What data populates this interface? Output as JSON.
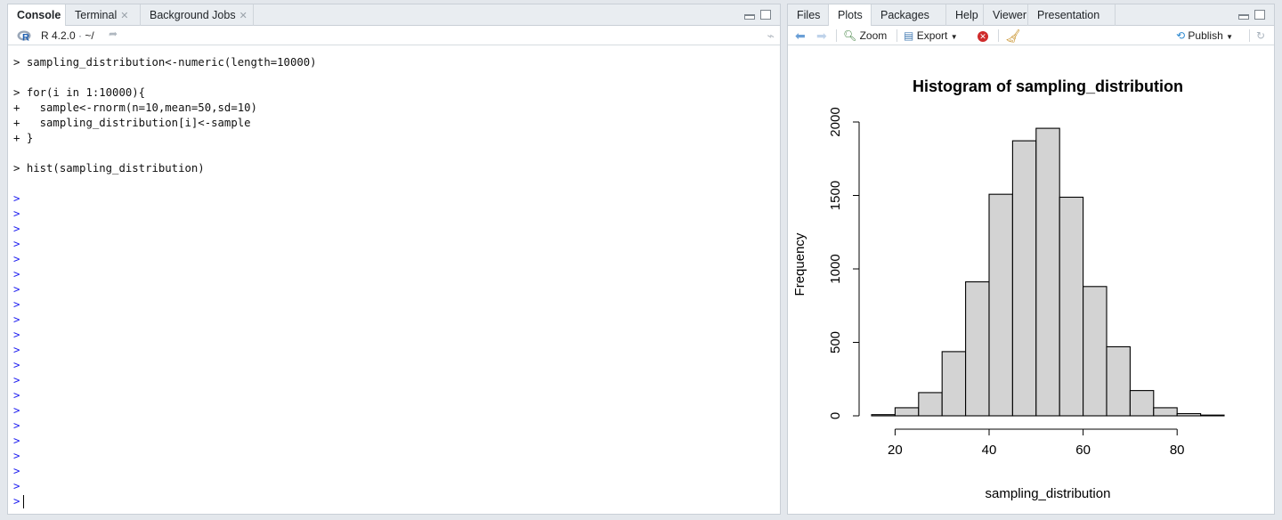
{
  "console_pane": {
    "tabs": [
      {
        "label": "Console",
        "active": true,
        "closable": false
      },
      {
        "label": "Terminal",
        "active": false,
        "closable": true
      },
      {
        "label": "Background Jobs",
        "active": false,
        "closable": true
      }
    ],
    "r_version": "R 4.2.0",
    "working_dir": "~/",
    "lines": [
      {
        "prompt": ">",
        "text": "sampling_distribution<-numeric(length=10000)"
      },
      {
        "prompt": "",
        "text": ""
      },
      {
        "prompt": ">",
        "text": "for(i in 1:10000){"
      },
      {
        "prompt": "+",
        "text": "  sample<-rnorm(n=10,mean=50,sd=10)"
      },
      {
        "prompt": "+",
        "text": "  sampling_distribution[i]<-sample"
      },
      {
        "prompt": "+",
        "text": "}"
      },
      {
        "prompt": "",
        "text": ""
      },
      {
        "prompt": ">",
        "text": "hist(sampling_distribution)"
      }
    ],
    "empty_prompt_count": 20,
    "prompt_symbol": ">",
    "colors": {
      "prompt_blue": "#1a1af0"
    }
  },
  "plots_pane": {
    "tabs": [
      {
        "label": "Files",
        "active": false
      },
      {
        "label": "Plots",
        "active": true
      },
      {
        "label": "Packages",
        "active": false
      },
      {
        "label": "Help",
        "active": false
      },
      {
        "label": "Viewer",
        "active": false
      },
      {
        "label": "Presentation",
        "active": false
      }
    ],
    "toolbar": {
      "zoom_label": "Zoom",
      "export_label": "Export",
      "publish_label": "Publish"
    }
  },
  "chart_data": {
    "type": "bar",
    "title": "Histogram of sampling_distribution",
    "xlabel": "sampling_distribution",
    "ylabel": "Frequency",
    "bin_edges": [
      15,
      20,
      25,
      30,
      35,
      40,
      45,
      50,
      55,
      60,
      65,
      70,
      75,
      80,
      85,
      90
    ],
    "values": [
      8,
      55,
      158,
      437,
      912,
      1508,
      1872,
      1957,
      1488,
      880,
      470,
      172,
      55,
      15,
      5
    ],
    "xlim": [
      15,
      90
    ],
    "ylim": [
      0,
      2000
    ],
    "x_ticks": [
      20,
      40,
      60,
      80
    ],
    "y_ticks": [
      0,
      500,
      1000,
      1500,
      2000
    ],
    "bar_fill": "#d3d3d3",
    "bar_stroke": "#000000"
  }
}
